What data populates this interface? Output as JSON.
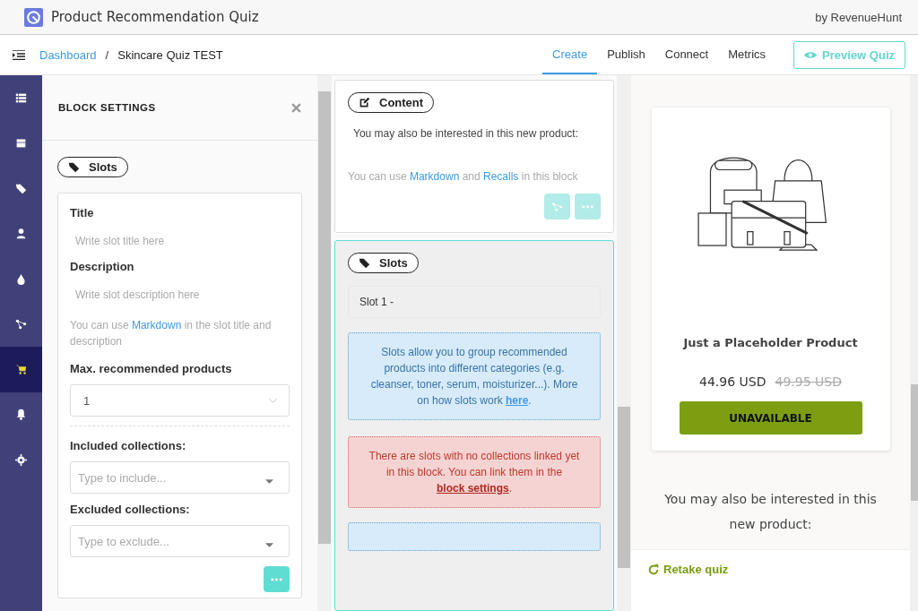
{
  "app": {
    "title": "Product Recommendation Quiz",
    "by": "by RevenueHunt"
  },
  "breadcrumb_separator": "/",
  "breadcrumb": [
    {
      "label": "Dashboard",
      "link": true
    },
    {
      "label": "Skincare Quiz TEST",
      "link": false
    }
  ],
  "tabs": [
    {
      "label": "Create",
      "selected": true
    },
    {
      "label": "Publish",
      "selected": false
    },
    {
      "label": "Connect",
      "selected": false
    },
    {
      "label": "Metrics",
      "selected": false
    }
  ],
  "preview_button": "Preview Quiz",
  "sidebar": {
    "items": [
      {
        "selected": false
      },
      {
        "selected": false
      },
      {
        "selected": false
      },
      {
        "selected": false
      },
      {
        "selected": false
      },
      {
        "selected": false
      },
      {
        "selected": true
      },
      {
        "selected": false
      },
      {
        "selected": false
      }
    ]
  },
  "settings": {
    "title": "BLOCK SETTINGS",
    "tag": "Slots",
    "title_label": "Title",
    "title_placeholder": "Write slot title here",
    "description_label": "Description",
    "description_placeholder": "Write slot description here",
    "hint": [
      {
        "text": "You can use ",
        "link": false
      },
      {
        "text": "Markdown",
        "link": true
      },
      {
        "text": " in the slot title and description",
        "link": false
      }
    ],
    "max_label": "Max. recommended products",
    "max_value": "1",
    "included_label": "Included collections:",
    "included_placeholder": "Type to include...",
    "excluded_label": "Excluded collections:",
    "excluded_placeholder": "Type to exclude..."
  },
  "content_block": {
    "tag": "Content",
    "text": "You may also be interested in this new product:",
    "hint": [
      {
        "text": "You can use ",
        "link": false
      },
      {
        "text": "Markdown",
        "link": true
      },
      {
        "text": " and ",
        "link": false
      },
      {
        "text": "Recalls",
        "link": true
      },
      {
        "text": " in this block",
        "link": false
      }
    ]
  },
  "slots_block": {
    "tag": "Slots",
    "slot": "Slot 1 -",
    "info": [
      {
        "text": "Slots allow you to group recommended products into different categories (e.g. cleanser, toner, serum, moisturizer...). More on how slots work ",
        "link": false
      },
      {
        "text": "here",
        "link": true
      },
      {
        "text": ".",
        "link": false
      }
    ],
    "warning": [
      {
        "text": "There are slots with no collections linked yet in this block. You can link them in the ",
        "link": false
      },
      {
        "text": "block settings",
        "link": true
      },
      {
        "text": ".",
        "link": false
      }
    ]
  },
  "preview": {
    "product": "Just a Placeholder Product",
    "price": "44.96 USD",
    "old_price": "49.95 USD",
    "button": "UNAVAILABLE",
    "text": "You may also be interested in this new product:",
    "retake": "Retake quiz"
  }
}
